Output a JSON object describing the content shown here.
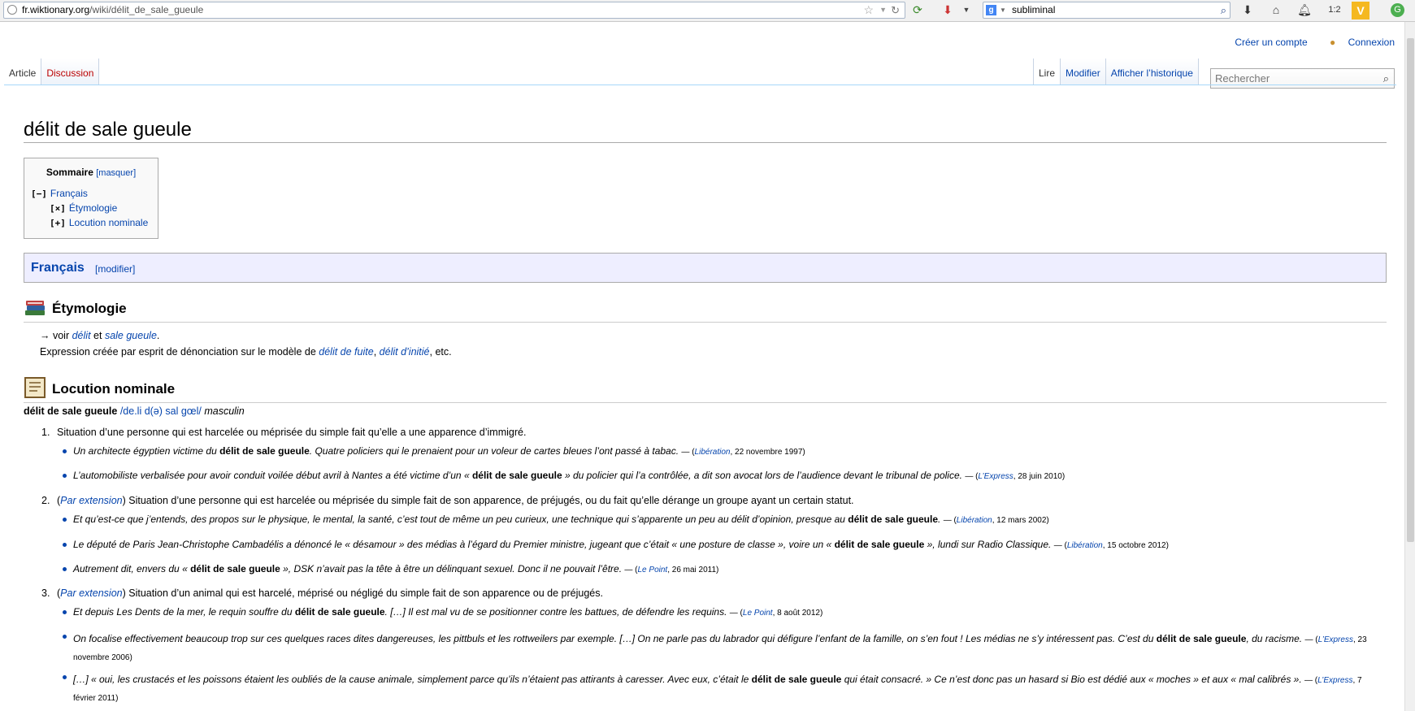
{
  "browser": {
    "url_domain": "fr.wiktionary.org",
    "url_path": "/wiki/délit_de_sale_gueule",
    "search_text": "subliminal",
    "counter": "1:2"
  },
  "personal": {
    "create_account": "Créer un compte",
    "login": "Connexion"
  },
  "tabs": {
    "article": "Article",
    "discussion": "Discussion",
    "read": "Lire",
    "edit": "Modifier",
    "history": "Afficher l’historique",
    "search_placeholder": "Rechercher"
  },
  "page": {
    "title": "délit de sale gueule"
  },
  "toc": {
    "title": "Sommaire",
    "toggle": "[masquer]",
    "items": [
      {
        "marker": "[−]",
        "label": "Français"
      },
      {
        "marker": "[×]",
        "label": "Étymologie"
      },
      {
        "marker": "[+]",
        "label": "Locution nominale"
      }
    ]
  },
  "language": {
    "name": "Français",
    "edit": "[modifier]"
  },
  "etymology": {
    "title": "Étymologie",
    "line1_prefix": "→ voir",
    "line1_link1": "délit",
    "line1_and": "et",
    "line1_link2": "sale gueule",
    "line1_end": ".",
    "line2_prefix": "Expression créée par esprit de dénonciation sur le modèle de",
    "line2_link1": "délit de fuite",
    "line2_comma": ",",
    "line2_link2": "délit d’initié",
    "line2_end": ", etc."
  },
  "locution": {
    "title": "Locution nominale",
    "headword": "délit de sale gueule",
    "pronunciation": "/de.li d(ə) sal gœl/",
    "gender": "masculin",
    "definitions": [
      {
        "num": "1.",
        "context": "",
        "text": "Situation d’une personne qui est harcelée ou méprisée du simple fait qu’elle a une apparence d’immigré.",
        "quotes": [
          {
            "pre": "Un architecte égyptien victime du ",
            "bold": "délit de sale gueule",
            "post": ". Quatre policiers qui le prenaient pour un voleur de cartes bleues l’ont passé à tabac.",
            "source": "Libération",
            "date": ", 22 novembre 1997)"
          },
          {
            "pre": "L’automobiliste verbalisée pour avoir conduit voilée début avril à Nantes a été victime d’un « ",
            "bold": "délit de sale gueule",
            "post": " » du policier qui l’a contrôlée, a dit son avocat lors de l’audience devant le tribunal de police.",
            "source": "L’Express",
            "date": ", 28 juin 2010)"
          }
        ]
      },
      {
        "num": "2.",
        "context": "Par extension",
        "text": "Situation d’une personne qui est harcelée ou méprisée du simple fait de son apparence, de préjugés, ou du fait qu’elle dérange un groupe ayant un certain statut.",
        "quotes": [
          {
            "pre": "Et qu’est-ce que j’entends, des propos sur le physique, le mental, la santé, c’est tout de même un peu curieux, une technique qui s’apparente un peu au délit d’opinion, presque au ",
            "bold": "délit de sale gueule",
            "post": ".",
            "source": "Libération",
            "date": ", 12 mars 2002)"
          },
          {
            "pre": "Le député de Paris Jean-Christophe Cambadélis a dénoncé le « désamour » des médias à l’égard du Premier ministre, jugeant que c’était « une posture de classe », voire un « ",
            "bold": "délit de sale gueule",
            "post": " », lundi sur Radio Classique.",
            "source": "Libération",
            "date": ", 15 octobre 2012)"
          },
          {
            "pre": "Autrement dit, envers du « ",
            "bold": "délit de sale gueule",
            "post": " », DSK n’avait pas la tête à être un délinquant sexuel. Donc il ne pouvait l’être.",
            "source": "Le Point",
            "date": ", 26 mai 2011)"
          }
        ]
      },
      {
        "num": "3.",
        "context": "Par extension",
        "text": "Situation d’un animal qui est harcelé, méprisé ou négligé du simple fait de son apparence ou de préjugés.",
        "quotes": [
          {
            "pre": "Et depuis Les Dents de la mer, le requin souffre du ",
            "bold": "délit de sale gueule",
            "post": ". […] Il est mal vu de se positionner contre les battues, de défendre les requins.",
            "source": "Le Point",
            "date": ", 8 août 2012)"
          },
          {
            "pre": "On focalise effectivement beaucoup trop sur ces quelques races dites dangereuses, les pittbuls et les rottweilers par exemple. […] On ne parle pas du labrador qui défigure l’enfant de la famille, on s’en fout ! Les médias ne s’y intéressent pas. C’est du ",
            "bold": "délit de sale gueule",
            "post": ", du racisme.",
            "source": "L’Express",
            "date": ", 23 novembre 2006)"
          },
          {
            "pre": "[…] « oui, les crustacés et les poissons étaient les oubliés de la cause animale, simplement parce qu’ils n’étaient pas attirants à caresser. Avec eux, c’était le ",
            "bold": "délit de sale gueule",
            "post": " qui était consacré. » Ce n’est donc pas un hasard si Bio est dédié aux « moches » et aux « mal calibrés ».",
            "source": "L’Express",
            "date": ", 7 février 2011)"
          }
        ]
      }
    ]
  }
}
